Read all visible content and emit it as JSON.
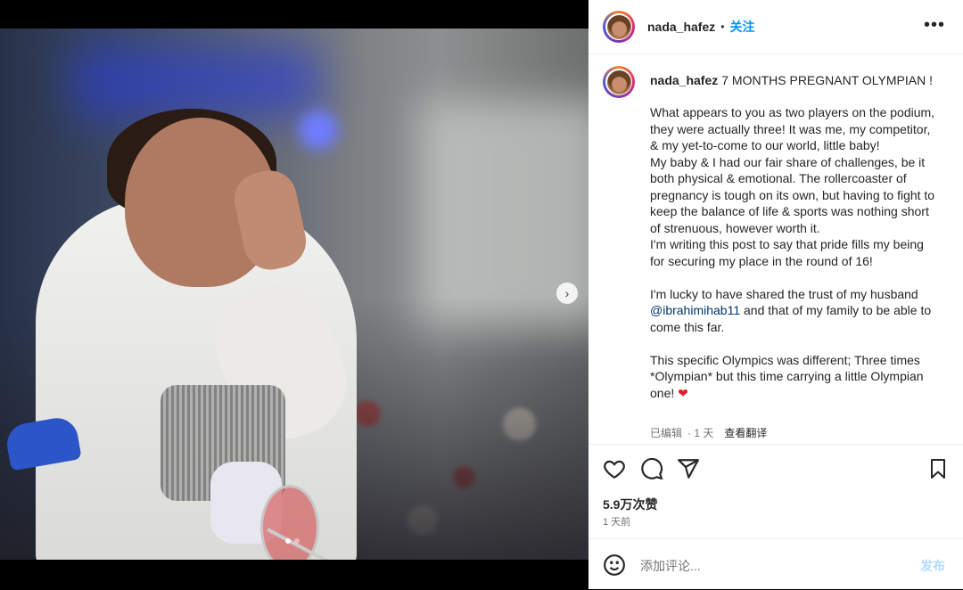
{
  "post": {
    "username": "nada_hafez",
    "follow_label": "关注",
    "separator": "•",
    "more_label": "•••",
    "caption_title": "7 MONTHS PREGNANT OLYMPIAN !",
    "caption_p1": "What appears to you as two players on the podium, they were actually three! It was me, my competitor, & my yet-to-come to our world, little baby!\nMy baby & I had our fair share of challenges, be it both physical & emotional. The rollercoaster of pregnancy is tough on its own, but having to fight to keep the balance of life & sports was nothing short of strenuous, however worth it.\nI'm writing this post to say that pride fills my being for securing my place in the round of 16!",
    "caption_p2_before": "I'm lucky to have shared the trust of my husband ",
    "mention": "@ibrahimihab11",
    "caption_p2_after": " and that of my family to be able to come this far.",
    "caption_p3": "This specific Olympics was different; Three times *Olympian* but this time carrying a little Olympian one! ",
    "emoji": "❤",
    "edited": "已编辑",
    "edited_time": "· 1 天",
    "see_translation": "查看翻译",
    "likes": "5.9万次赞",
    "posted_time": "1 天前",
    "comment_placeholder": "添加评论...",
    "post_label": "发布"
  },
  "media": {
    "next_icon": "chevron-right-icon",
    "slides": 2,
    "current_slide": 1
  },
  "colors": {
    "accent": "#0095f6",
    "heart": "#e11d2b",
    "mention": "#00376b"
  }
}
